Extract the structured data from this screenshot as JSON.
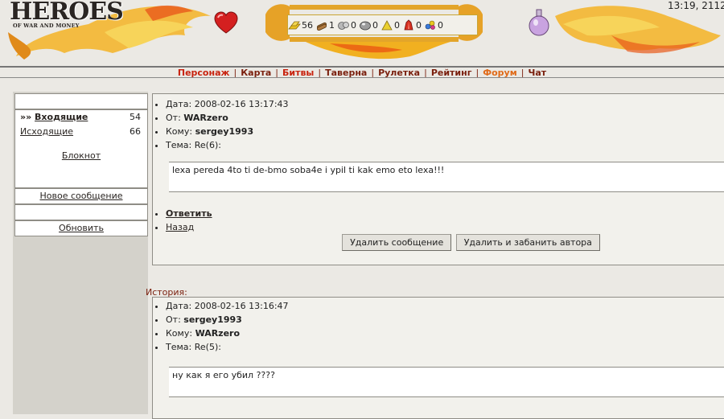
{
  "header": {
    "logo_title": "HEROES",
    "logo_subtitle": "OF WAR AND MONEY",
    "clock": "13:19, 2112",
    "resources": [
      {
        "icon": "gold-icon",
        "value": "56"
      },
      {
        "icon": "wood-icon",
        "value": "1"
      },
      {
        "icon": "ore-icon",
        "value": "0"
      },
      {
        "icon": "mercury-icon",
        "value": "0"
      },
      {
        "icon": "sulfur-icon",
        "value": "0"
      },
      {
        "icon": "crystal-icon",
        "value": "0"
      },
      {
        "icon": "gems-icon",
        "value": "0"
      }
    ]
  },
  "nav": {
    "items": [
      {
        "label": "Персонаж"
      },
      {
        "label": "Карта"
      },
      {
        "label": "Битвы"
      },
      {
        "label": "Таверна"
      },
      {
        "label": "Рулетка"
      },
      {
        "label": "Рейтинг"
      },
      {
        "label": "Форум"
      },
      {
        "label": "Чат"
      }
    ]
  },
  "sidebar": {
    "inbox_prefix": "»» ",
    "inbox_label": "Входящие",
    "inbox_count": "54",
    "outbox_label": "Исходящие",
    "outbox_count": "66",
    "notepad_label": "Блокнот",
    "new_message_label": "Новое сообщение",
    "refresh_label": "Обновить"
  },
  "message": {
    "date_label": "Дата:",
    "date_value": "2008-02-16 13:17:43",
    "from_label": "От:",
    "from_value": "WARzero",
    "to_label": "Кому:",
    "to_value": "sergey1993",
    "subject_label": "Тема:",
    "subject_value": "Re(6):",
    "body": "lexa pereda  4to ti de-bmo soba4e i ypil ti kak emo eto lexa!!!",
    "reply_label": "Ответить",
    "back_label": "Назад",
    "delete_button": "Удалить сообщение",
    "delete_ban_button": "Удалить и забанить автора"
  },
  "history": {
    "label": "История:",
    "date_label": "Дата:",
    "date_value": "2008-02-16 13:16:47",
    "from_label": "От:",
    "from_value": "sergey1993",
    "to_label": "Кому:",
    "to_value": "WARzero",
    "subject_label": "Тема:",
    "subject_value": "Re(5):",
    "body": "ну как я его убил ????"
  }
}
